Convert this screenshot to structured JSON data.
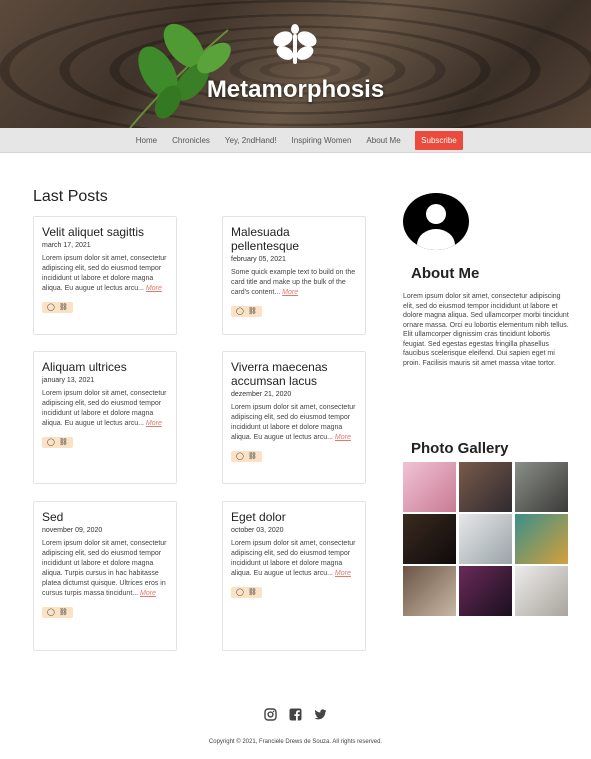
{
  "site": {
    "title": "Metamorphosis"
  },
  "nav": {
    "items": [
      {
        "label": "Home"
      },
      {
        "label": "Chronicles"
      },
      {
        "label": "Yey, 2ndHand!"
      },
      {
        "label": "Inspiring Women"
      },
      {
        "label": "About Me"
      }
    ],
    "subscribe_label": "Subscribe"
  },
  "main": {
    "section_title": "Last Posts",
    "posts": [
      {
        "title": "Velit aliquet sagittis",
        "date": "march 17, 2021",
        "text": "Lorem ipsum dolor sit amet, consectetur adipiscing elit, sed do eiusmod tempor incididunt ut labore et dolore magna aliqua. Eu augue ut lectus arcu...",
        "more": "More"
      },
      {
        "title": "Malesuada pellentesque",
        "date": "february 05, 2021",
        "text": "Some quick example text to build on the card title and make up the bulk of the card's content...",
        "more": "More"
      },
      {
        "title": "Aliquam ultrices",
        "date": "january 13, 2021",
        "text": "Lorem ipsum dolor sit amet, consectetur adipiscing elit, sed do eiusmod tempor incididunt ut labore et dolore magna aliqua. Eu augue ut lectus arcu...",
        "more": "More"
      },
      {
        "title": "Viverra maecenas accumsan lacus",
        "date": "dezember 21, 2020",
        "text": "Lorem ipsum dolor sit amet, consectetur adipiscing elit, sed do eiusmod tempor incididunt ut labore et dolore magna aliqua. Eu augue ut lectus arcu...",
        "more": "More"
      },
      {
        "title": "Sed",
        "date": "november 09, 2020",
        "text": "Lorem ipsum dolor sit amet, consectetur adipiscing elit, sed do eiusmod tempor incididunt ut labore et dolore magna aliqua. Turpis cursus in hac habitasse platea dictumst quisque. Ultrices eros in cursus turpis massa tincidunt...",
        "more": "More"
      },
      {
        "title": "Eget dolor",
        "date": "october 03, 2020",
        "text": "Lorem ipsum dolor sit amet, consectetur adipiscing elit, sed do eiusmod tempor incididunt ut labore et dolore magna aliqua. Eu augue ut lectus arcu...",
        "more": "More"
      }
    ]
  },
  "sidebar": {
    "about_title": "About Me",
    "about_text": "Lorem ipsum dolor sit amet, consectetur adipiscing elit, sed do eiusmod tempor incididunt ut labore et dolore magna aliqua. Sed ullamcorper morbi tincidunt ornare massa. Orci eu lobortis elementum nibh tellus. Elit ullamcorper dignissim cras tincidunt lobortis feugiat. Sed egestas egestas fringilla phasellus faucibus scelerisque eleifend. Dui sapien eget mi proin. Facilisis mauris sit amet massa vitae tortor.",
    "gallery_title": "Photo Gallery",
    "photos": [
      {
        "name": "cherry-blossom",
        "colors": [
          "#f1c3d4",
          "#c97a95"
        ]
      },
      {
        "name": "mountain-sunset",
        "colors": [
          "#7a5a4a",
          "#2f2a30"
        ]
      },
      {
        "name": "person-grass",
        "colors": [
          "#8a8f88",
          "#3b3a38"
        ]
      },
      {
        "name": "dark-hallway",
        "colors": [
          "#3a2a20",
          "#0e0b0a"
        ]
      },
      {
        "name": "office-desk",
        "colors": [
          "#e6e8ea",
          "#9aa3a8"
        ]
      },
      {
        "name": "colorful-eggs",
        "colors": [
          "#3a8f8a",
          "#d4a03a"
        ]
      },
      {
        "name": "bedroom-lamp",
        "colors": [
          "#6a5545",
          "#c9b7a5"
        ]
      },
      {
        "name": "concert-lights",
        "colors": [
          "#6a2a5a",
          "#1a0f1e"
        ]
      },
      {
        "name": "flatlay-notebook",
        "colors": [
          "#ececec",
          "#a9a49c"
        ]
      }
    ]
  },
  "footer": {
    "social": [
      {
        "icon": "instagram-icon"
      },
      {
        "icon": "facebook-icon"
      },
      {
        "icon": "twitter-icon"
      }
    ],
    "copyright": "Copyright © 2021, Franciele Drews de Souza. All rights reserved."
  },
  "colors": {
    "accent": "#ea4b3c",
    "more_link": "#e07a6a",
    "action_bg": "#fbe2c4",
    "nav_bg": "#e6e6e6"
  }
}
